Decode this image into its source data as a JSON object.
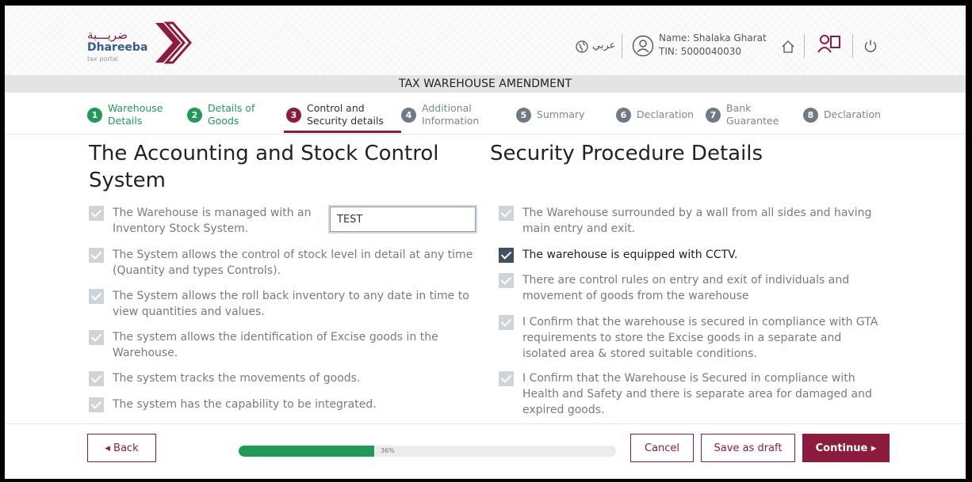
{
  "header": {
    "logo_arabic": "ضريـــبة",
    "logo_name": "Dhareeba",
    "logo_sub": "tax portal",
    "language_link": "عربي",
    "user_name": "Name: Shalaka Gharat",
    "user_tin": "TIN: 5000040030"
  },
  "page_title": "TAX WAREHOUSE AMENDMENT",
  "steps": [
    {
      "num": "1",
      "label": "Warehouse\nDetails",
      "state": "done"
    },
    {
      "num": "2",
      "label": "Details of\nGoods",
      "state": "done"
    },
    {
      "num": "3",
      "label": "Control and\nSecurity details",
      "state": "active"
    },
    {
      "num": "4",
      "label": "Additional\nInformation",
      "state": "todo"
    },
    {
      "num": "5",
      "label": "Summary",
      "state": "todo"
    },
    {
      "num": "6",
      "label": "Declaration",
      "state": "todo"
    },
    {
      "num": "7",
      "label": "Bank\nGuarantee",
      "state": "todo"
    },
    {
      "num": "8",
      "label": "Declaration",
      "state": "todo"
    }
  ],
  "accounting": {
    "heading": "The Accounting and Stock Control System",
    "input_value": "TEST",
    "items": [
      {
        "text": "The Warehouse is managed with an Inventory Stock System.",
        "checked": true
      },
      {
        "text": "The System allows the control of stock level in detail at any time (Quantity and types Controls).",
        "checked": true
      },
      {
        "text": "The System allows the roll back inventory to any date in time to view quantities and values.",
        "checked": true
      },
      {
        "text": "The system allows the identification of Excise goods in the Warehouse.",
        "checked": true
      },
      {
        "text": "The system tracks the movements of goods.",
        "checked": true
      },
      {
        "text": "The system has the capability to be integrated.",
        "checked": true
      }
    ]
  },
  "security": {
    "heading": "Security Procedure Details",
    "items": [
      {
        "text": "The Warehouse surrounded by a wall from all sides and having main entry and exit.",
        "checked": true
      },
      {
        "text": "The warehouse is equipped with CCTV.",
        "checked": true
      },
      {
        "text": "There are control rules on entry and exit of individuals and movement of goods from the warehouse",
        "checked": true
      },
      {
        "text": "I Confirm that the warehouse is secured in compliance with GTA requirements to store the Excise goods in a separate and isolated area & stored suitable conditions.",
        "checked": true
      },
      {
        "text": "I Confirm that the Warehouse is Secured in compliance with Health and Safety and there is separate area for damaged and expired goods.",
        "checked": true
      }
    ]
  },
  "footer": {
    "back_label": "◂  Back",
    "progress_text": "36%",
    "progress_value": 0.36,
    "cancel_label": "Cancel",
    "save_label": "Save as draft",
    "continue_label": "Continue  ▸"
  },
  "colors": {
    "brand": "#8d1b3d",
    "done": "#1f9a57",
    "todo": "#6f7a84",
    "checkbox_active": "#3f5161",
    "checkbox_inactive": "#cfd4d8"
  },
  "icons": [
    "globe-icon",
    "user-icon",
    "home-icon",
    "users-book-icon",
    "power-icon",
    "logo-mark-icon"
  ]
}
